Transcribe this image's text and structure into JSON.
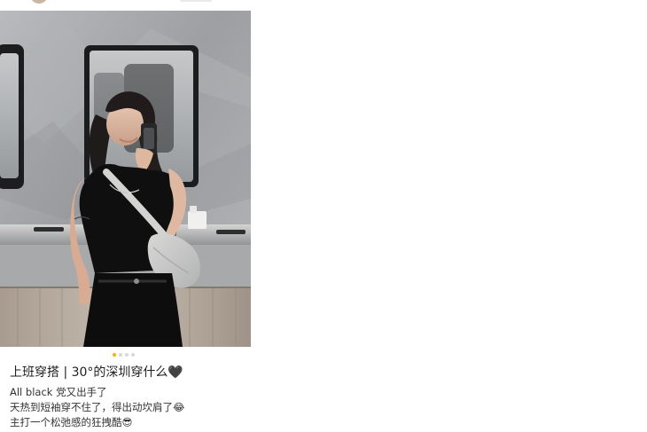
{
  "post": {
    "title": "上班穿搭 | 30°的深圳穿什么🖤",
    "lines": [
      "All black 党又出手了",
      "天热到短袖穿不住了，得出动坎肩了😂",
      "主打一个松弛感的狂拽酷😎"
    ]
  },
  "carousel": {
    "current_index": 1,
    "total": 4,
    "active_color": "#f4b400",
    "inactive_color": "#d8d8d8"
  },
  "icons": {
    "author_avatar": "avatar",
    "top_action": "toolbar-hint"
  },
  "colors": {
    "background": "#ffffff",
    "title_text": "#1e1e1e",
    "body_text": "#333333"
  }
}
